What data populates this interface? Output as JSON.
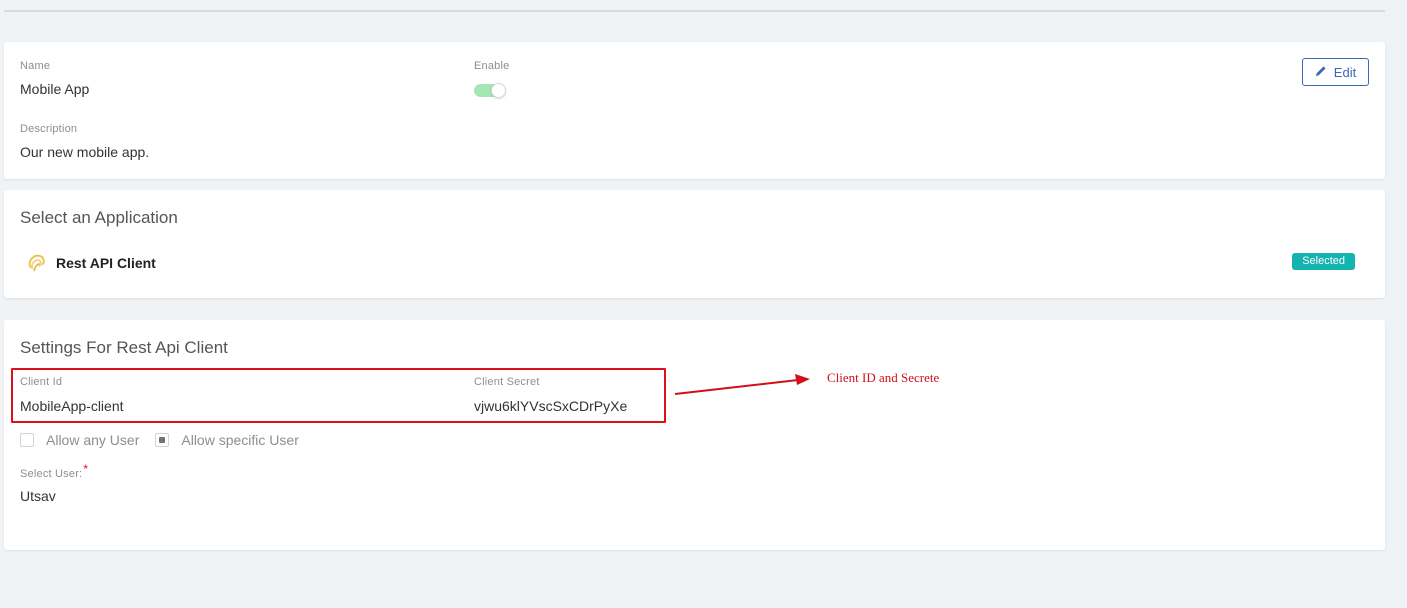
{
  "app": {
    "name_label": "Name",
    "name_value": "Mobile App",
    "enable_label": "Enable",
    "enabled": true,
    "description_label": "Description",
    "description_value": "Our new mobile app.",
    "edit_label": "Edit"
  },
  "application": {
    "title": "Select an Application",
    "name": "Rest API Client",
    "status_badge": "Selected"
  },
  "settings": {
    "title": "Settings For Rest Api Client",
    "client_id_label": "Client Id",
    "client_id_value": "MobileApp-client",
    "client_secret_label": "Client Secret",
    "client_secret_value": "vjwu6klYVscSxCDrPyXe",
    "allow_any_label": "Allow any User",
    "allow_any_checked": false,
    "allow_specific_label": "Allow specific User",
    "allow_specific_checked": true,
    "select_user_label": "Select User:",
    "required_mark": "*",
    "selected_user": "Utsav"
  },
  "annotation": {
    "text": "Client ID and Secrete",
    "color": "#d0101a"
  },
  "colors": {
    "accent": "#3a68b5",
    "badge": "#13b3b0",
    "toggle_on": "#a6e5b4",
    "highlight_box": "#e0101b"
  },
  "icons": {
    "edit": "pencil-icon",
    "application": "rest-api-client-icon"
  }
}
